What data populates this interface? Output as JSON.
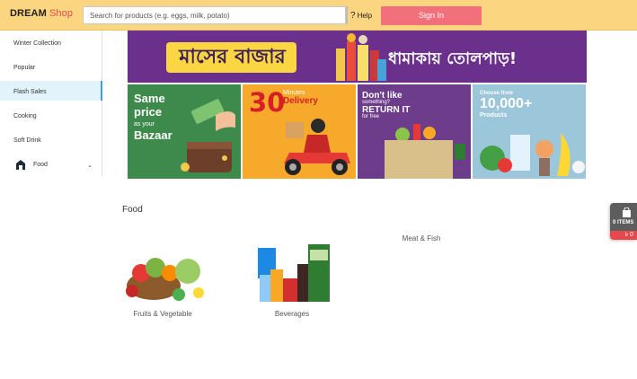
{
  "header": {
    "brand_part1": "DREAM",
    "brand_part2": "Shop",
    "search_placeholder": "Search for products (e.g. eggs, milk, potato)",
    "help_label": "Help",
    "signin_label": "Sign In",
    "accent_color": "#fcd581",
    "signin_color": "#f2707a"
  },
  "sidebar": {
    "items": [
      {
        "label": "Winter Collection",
        "active": false
      },
      {
        "label": "Popular",
        "active": false
      },
      {
        "label": "Flash Sales",
        "active": true
      },
      {
        "label": "Cooking",
        "active": false
      },
      {
        "label": "Soft Drink",
        "active": false
      },
      {
        "label": "Food",
        "active": false,
        "icon": "food-icon",
        "has_dropdown": true
      }
    ]
  },
  "banners": {
    "top": {
      "title": "মাসের বাজার",
      "subtitle": "ধামাকায় তোলপাড়!"
    },
    "tiles": [
      {
        "line1": "Same",
        "line2": "price",
        "line3": "as your",
        "line4": "Bazaar"
      },
      {
        "number": "30",
        "line1": "Minutes",
        "line2": "Delivery"
      },
      {
        "line1": "Don't like",
        "line2": "something?",
        "line3": "RETURN IT",
        "line4": "for free"
      },
      {
        "line1": "Choose from",
        "line2": "10,000+",
        "line3": "Products"
      }
    ]
  },
  "section": {
    "title": "Food",
    "categories": [
      {
        "label": "Fruits & Vegetable"
      },
      {
        "label": "Beverages"
      },
      {
        "label": "Meat & Fish"
      }
    ]
  },
  "cart": {
    "items_label": "0 ITEMS",
    "total": "৳ 0"
  }
}
